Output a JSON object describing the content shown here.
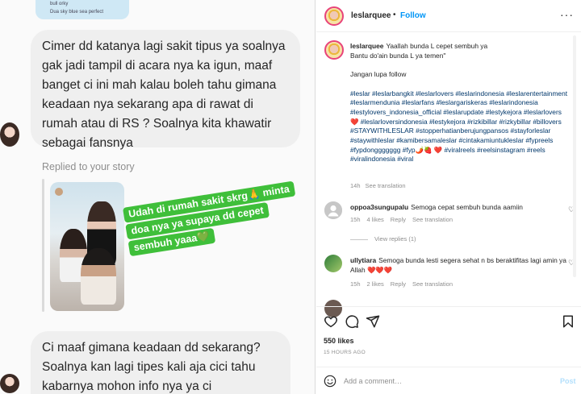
{
  "chat": {
    "top_strip_line1": "bull orky",
    "top_strip_line2": "Dua sky blue sea perfect",
    "message1": "Cimer dd katanya lagi sakit tipus ya soalnya gak jadi tampil di acara nya ka igun, maaf banget ci ini mah kalau boleh tahu gimana keadaan nya sekarang apa di rawat di rumah atau di RS ? Soalnya kita khawatir sebagai fansnya",
    "replied_label": "Replied to your story",
    "story_sticker": [
      "Udah di rumah sakit skrg🙏 minta",
      "doa nya ya supaya dd cepet",
      "sembuh yaaa💚"
    ],
    "message2": "Ci maaf gimana keadaan dd sekarang? Soalnya kan lagi tipes kali aja cici tahu kabarnya mohon info nya ya ci"
  },
  "post": {
    "username": "leslarquee",
    "follow_label": "Follow",
    "more_label": "···",
    "caption_line1": "Yaallah bunda L cepet sembuh ya",
    "caption_line2": "Bantu do'ain bunda L ya temen\"",
    "caption_line3": "Jangan lupa follow",
    "hashtags": "#leslar #leslarbangkit #leslarlovers #leslarindonesia #leslarentertainment #leslarmendunia #leslarfans #leslargariskeras #leslarindonesia #lestylovers_indonesia_official #leslarupdate #lestykejora #leslarlovers❤️ #leslarloversindonesia #lestykejora #rizkibillar #rizkybillar #billovers #STAYWITHLESLAR #stopperhatianberujungpansos #stayforleslar #staywithleslar #kamibersamaleslar #cintakamiuntukleslar #fypreels #fypdonggggggg #fyp🌶️🍓 ❤️ #viralreels #reelsinstagram #reels #viralindonesia #viral",
    "caption_time": "14h",
    "caption_see_translation": "See translation",
    "comments": [
      {
        "user": "oppoa3sungupalu",
        "text": "Semoga cepat sembuh bunda aamiin",
        "time": "15h",
        "likes": "4 likes",
        "reply": "Reply",
        "see_translation": "See translation"
      },
      {
        "user": "ullytiara",
        "text": "Semoga bunda lesti segera sehat n bs beraktifitas lagi amin ya Allah ❤️❤️❤️",
        "time": "15h",
        "likes": "2 likes",
        "reply": "Reply",
        "see_translation": "See translation"
      }
    ],
    "view_replies": "View replies (1)",
    "likes": "550 likes",
    "time_ago": "15 HOURS AGO",
    "comment_placeholder": "Add a comment…",
    "post_label": "Post"
  },
  "colors": {
    "accent_blue": "#0095f6",
    "sticker_green": "#3fbf3a",
    "bubble_gray": "#efefef",
    "heart_red": "#d12236"
  },
  "icons": [
    "heart-icon",
    "comment-icon",
    "share-icon",
    "bookmark-icon",
    "emoji-icon",
    "more-icon"
  ]
}
